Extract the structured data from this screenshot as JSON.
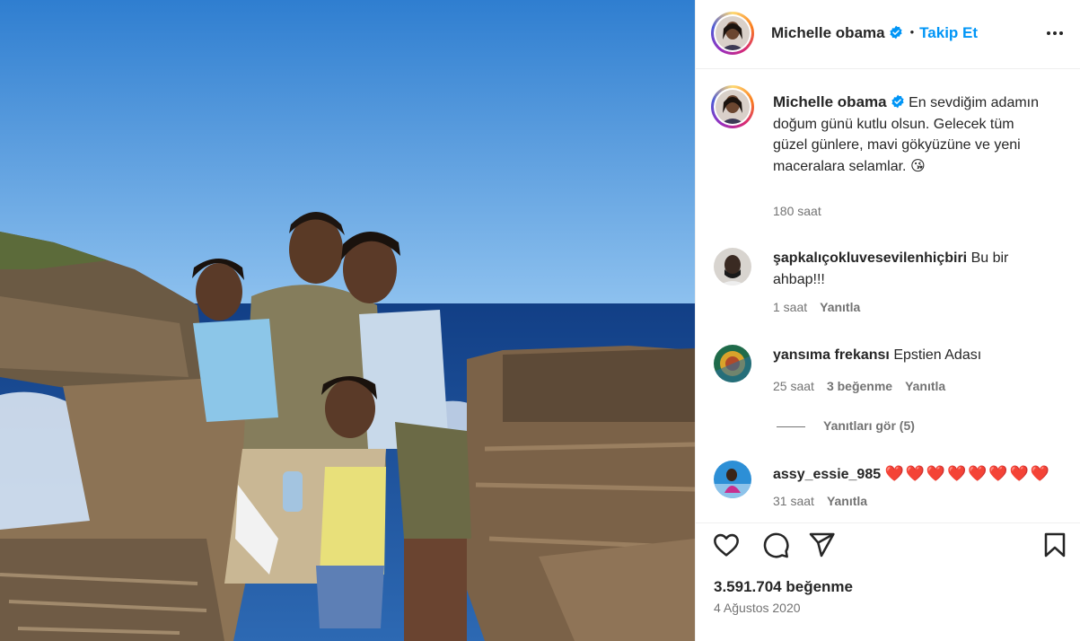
{
  "post": {
    "username": "Michelle obama",
    "dot": "•",
    "follow_label": "Takip Et",
    "caption": "En sevdiğim adamın doğum günü kutlu olsun. Gelecek tüm güzel günlere, mavi gökyüzüne ve yeni maceralara selamlar. 😘",
    "caption_time": "180 saat",
    "likes": "3.591.704 beğenme",
    "date": "4 Ağustos 2020"
  },
  "comments": [
    {
      "user": "şapkalıçokluvesevilenhiçbiri",
      "text": "Bu bir ahbap!!!",
      "time": "1 saat",
      "likes": "",
      "reply": "Yanıtla"
    },
    {
      "user": "yansıma frekansı",
      "text": "Epstien Adası",
      "time": "25 saat",
      "likes": "3 beğenme",
      "reply": "Yanıtla"
    },
    {
      "user": "assy_essie_985",
      "text": "❤️❤️❤️❤️❤️❤️❤️❤️",
      "time": "31 saat",
      "likes": "",
      "reply": "Yanıtla"
    }
  ],
  "view_replies": "Yanıtları gör (5)",
  "icons": {
    "like": "heart-icon",
    "comment": "comment-icon",
    "share": "share-icon",
    "save": "bookmark-icon",
    "more": "more-icon",
    "verified": "verified-badge-icon"
  },
  "colors": {
    "accent": "#0095f6",
    "verified": "#0095f6",
    "muted": "#737373",
    "heart": "#ed1c3f"
  }
}
